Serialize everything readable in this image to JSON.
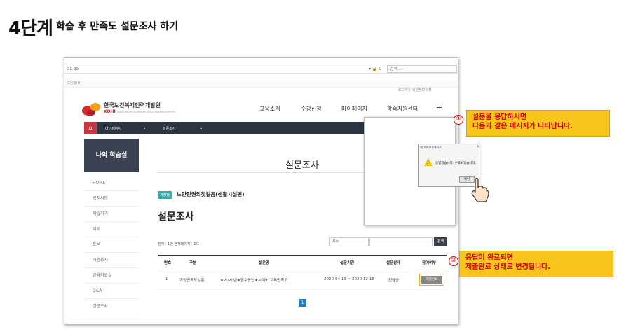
{
  "step": {
    "label": "4단계",
    "subtitle": "학습 후 만족도 설문조사 하기"
  },
  "browser": {
    "url": "01.do",
    "controls": "▾ 🔒 C",
    "search_placeholder": "검색...",
    "favorites": "도움말(H)",
    "top_links": "로그아웃   회원정보수정"
  },
  "site": {
    "logo_kr": "한국보건복지인력개발원",
    "logo_en": "KOHI",
    "logo_en_sub": "KOREA HEALTH & WELFARE SOCIAL SERVICE INSTITUTE",
    "nav": [
      "교육소개",
      "수강신청",
      "마이페이지",
      "학습지원센터"
    ],
    "menu_icon": "≡",
    "home_icon": "⌂",
    "breadcrumb": [
      "마이페이지",
      "설문조사"
    ],
    "chevron": "⌄"
  },
  "sidebar": {
    "title": "나의 학습실",
    "items": [
      "HOME",
      "공지사항",
      "학습하기",
      "과제",
      "토론",
      "시험응시",
      "교육자료실",
      "Q&A",
      "설문조사"
    ]
  },
  "main": {
    "title": "설문조사",
    "badge": "과정명",
    "course_name": "노인인권의첫걸음(생활시설편)",
    "section_title": "설문조사",
    "total": "전체 : 1건   현재페이지 : 1/1",
    "search_select": "제목",
    "search_button": "검색",
    "table": {
      "headers": [
        "번호",
        "구분",
        "설문명",
        "설문기간",
        "설문상태",
        "참여여부"
      ],
      "rows": [
        {
          "no": "1",
          "type": "과정만족도설문",
          "name": "★2020년★필수응답★사이버 교육만족도…",
          "period": "2020-04-13 ~ 2020-12-18",
          "status": "진행중",
          "action": "제출완료"
        }
      ]
    },
    "page": "1"
  },
  "dialog": {
    "title": "웹 페이지 메시지",
    "close": "✕",
    "icon": "!",
    "message": "응답했습니다. 수료되었습니다.",
    "ok": "확인"
  },
  "callouts": [
    {
      "num": "①",
      "lines": [
        "설문을 응답하시면",
        "다음과 같은 메시지가 나타납니다."
      ]
    },
    {
      "num": "②",
      "lines": [
        "응답이 완료되면",
        "제출완료 상태로 변경됩니다."
      ]
    }
  ],
  "colors": {
    "accent_red": "#c8353e",
    "teal_badge": "#3aa9a8",
    "callout_yellow": "#f8c51c",
    "dark_bar": "#2b3440",
    "pager_blue": "#2a79b8"
  }
}
